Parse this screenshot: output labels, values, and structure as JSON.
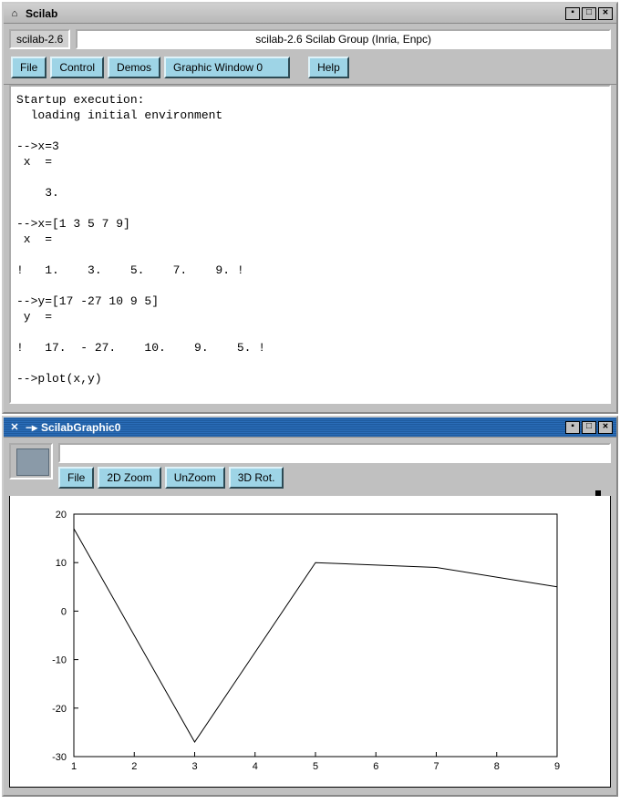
{
  "main_window": {
    "title": "Scilab",
    "label": "scilab-2.6",
    "banner": "scilab-2.6 Scilab Group (Inria, Enpc)",
    "toolbar": {
      "file": "File",
      "control": "Control",
      "demos": "Demos",
      "graphic_window": "Graphic Window  0",
      "help": "Help"
    },
    "console": "Startup execution:\n  loading initial environment\n\n-->x=3\n x  =\n\n    3.\n\n-->x=[1 3 5 7 9]\n x  =\n\n!   1.    3.    5.    7.    9. !\n\n-->y=[17 -27 10 9 5]\n y  =\n\n!   17.  - 27.    10.    9.    5. !\n\n-->plot(x,y)\n\n-->"
  },
  "graphic_window": {
    "title": "ScilabGraphic0",
    "toolbar": {
      "file": "File",
      "zoom": "2D Zoom",
      "unzoom": "UnZoom",
      "rot": "3D Rot."
    }
  },
  "chart_data": {
    "type": "line",
    "x": [
      1,
      3,
      5,
      7,
      9
    ],
    "y": [
      17,
      -27,
      10,
      9,
      5
    ],
    "xlim": [
      1,
      9
    ],
    "ylim": [
      -30,
      20
    ],
    "xticks": [
      1,
      2,
      3,
      4,
      5,
      6,
      7,
      8,
      9
    ],
    "yticks": [
      -30,
      -20,
      -10,
      0,
      10,
      20
    ],
    "title": "",
    "xlabel": "",
    "ylabel": ""
  }
}
